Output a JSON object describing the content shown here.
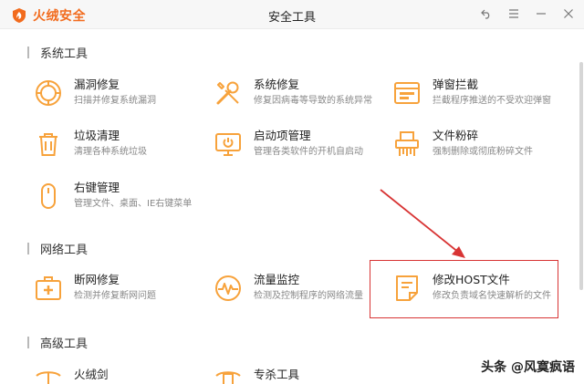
{
  "app": {
    "logo_text": "火绒安全",
    "window_title": "安全工具",
    "accent": "#f7a23b",
    "brand": "#f26b1d",
    "highlight": "#d83434"
  },
  "window_controls": {
    "back": "back-icon",
    "menu": "menu-icon",
    "minimize": "minimize-icon",
    "close": "close-icon"
  },
  "sections": [
    {
      "title": "系统工具"
    },
    {
      "title": "网络工具"
    },
    {
      "title": "高级工具"
    }
  ],
  "tools": {
    "leak_repair": {
      "name": "漏洞修复",
      "desc": "扫描并修复系统漏洞",
      "icon": "shield-icon"
    },
    "system_repair": {
      "name": "系统修复",
      "desc": "修复因病毒等导致的系统异常",
      "icon": "wrench-screwdriver-icon"
    },
    "popup_block": {
      "name": "弹窗拦截",
      "desc": "拦截程序推送的不受欢迎弹窗",
      "icon": "popup-window-icon"
    },
    "junk_clean": {
      "name": "垃圾清理",
      "desc": "清理各种系统垃圾",
      "icon": "trash-icon"
    },
    "startup_manage": {
      "name": "启动项管理",
      "desc": "管理各类软件的开机自启动",
      "icon": "monitor-power-icon"
    },
    "file_shred": {
      "name": "文件粉碎",
      "desc": "强制删除或彻底粉碎文件",
      "icon": "shredder-icon"
    },
    "right_click": {
      "name": "右键管理",
      "desc": "管理文件、桌面、IE右键菜单",
      "icon": "mouse-icon"
    },
    "net_repair": {
      "name": "断网修复",
      "desc": "检测并修复断网问题",
      "icon": "first-aid-icon"
    },
    "traffic_monitor": {
      "name": "流量监控",
      "desc": "检测及控制程序的网络流量",
      "icon": "gauge-icon"
    },
    "host_edit": {
      "name": "修改HOST文件",
      "desc": "修改负责域名快速解析的文件",
      "icon": "document-edit-icon"
    },
    "advanced_1": {
      "name": "火绒剑",
      "icon": "sword-icon"
    },
    "advanced_2": {
      "name": "专杀工具",
      "icon": "tool-icon"
    }
  },
  "watermark": "头条 @风寞疯语"
}
